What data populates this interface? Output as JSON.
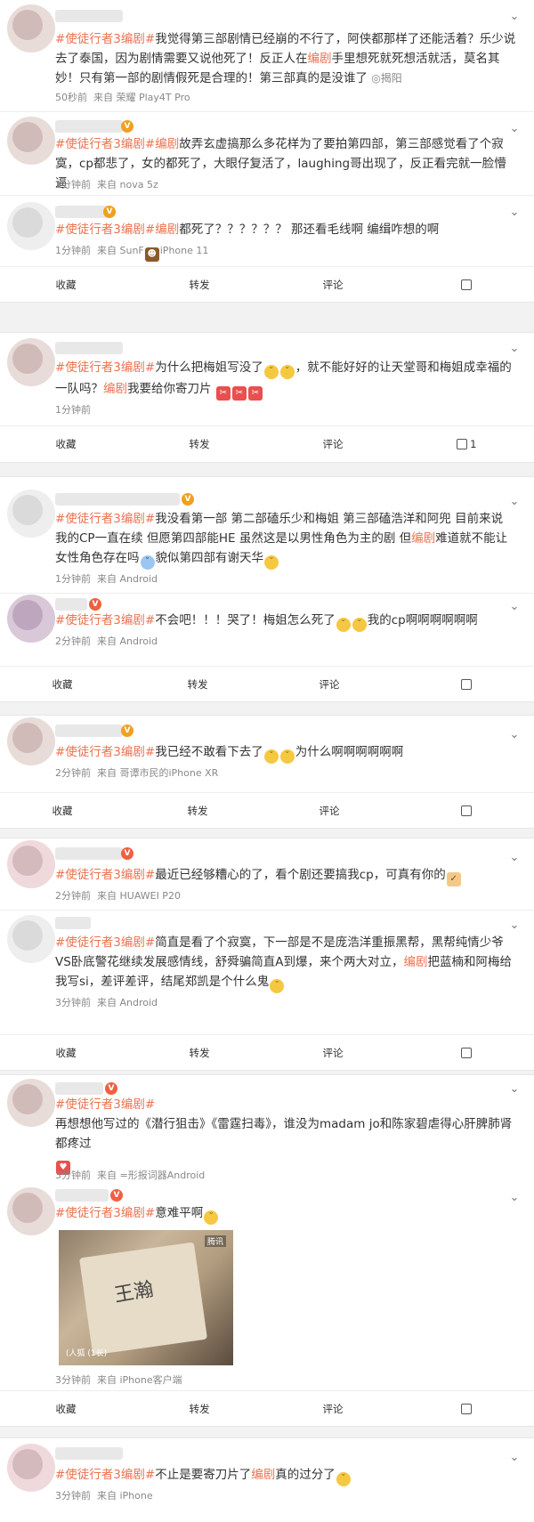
{
  "actions": {
    "collect": "收藏",
    "repost": "转发",
    "comment": "评论"
  },
  "tag": "#使徒行者3编剧#",
  "highlight": "编剧",
  "posts": [
    {
      "segments": [
        "我觉得第三部剧情已经崩的不行了，阿侠都那样了还能活着？乐少说去了泰国，因为剧情需要又说他死了！反正人在",
        "手里想死就死想活就活，莫名其妙！只有第一部的剧情假死是合理的！第三部真的是没谁了"
      ],
      "location": "揭阳",
      "time": "50秒前",
      "source": "来自 荣耀 Play4T Pro"
    },
    {
      "segments": [
        "故弄玄虚搞那么多花样为了要拍第四部，第三部感觉看了个寂寞，cp都悲了，女的都死了，大眼仔复活了，laughing哥出现了，反正看完就一脸懵逼"
      ],
      "time": "1分钟前",
      "source": "来自 nova 5z"
    },
    {
      "segments": [
        "都死了？？？？？？ 那还看毛线啊 编缉咋想的啊"
      ],
      "time": "1分钟前",
      "source_pre": "来自 SunF",
      "source_post": "iPhone 11",
      "like": ""
    },
    {
      "segments": [
        "为什么把梅姐写没了",
        "，就不能好好的让天堂哥和梅姐成幸福的一队吗？",
        "我要给你寄刀片"
      ],
      "time": "1分钟前",
      "like": "1"
    },
    {
      "segments": [
        "我没看第一部 第二部磕乐少和梅姐 第三部磕浩洋和阿兜 目前来说 我的CP一直在续 但愿第四部能HE 虽然这是以男性角色为主的剧 但",
        "难道就不能让女性角色存在吗",
        "貌似第四部有谢天华"
      ],
      "time": "1分钟前",
      "source": "来自 Android"
    },
    {
      "segments": [
        "不会吧！！！哭了！梅姐怎么死了",
        "我的cp啊啊啊啊啊啊"
      ],
      "time": "2分钟前",
      "source": "来自 Android"
    },
    {
      "segments": [
        "我已经不敢看下去了",
        "为什么啊啊啊啊啊啊"
      ],
      "time": "2分钟前",
      "source": "来自 哥谭市民的iPhone XR"
    },
    {
      "segments": [
        "最近已经够糟心的了，看个剧还要搞我cp，可真有你的"
      ],
      "time": "2分钟前",
      "source": "来自 HUAWEI P20"
    },
    {
      "segments": [
        "简直是看了个寂寞，下一部是不是庞浩洋重振黑帮，黑帮纯情少爷VS卧底警花继续发展感情线，舒舜骗简直A到爆，来个两大对立，",
        "把蓝楠和阿梅给我写si，差评差评，结尾郑凯是个什么鬼"
      ],
      "time": "3分钟前",
      "source": "来自 Android"
    },
    {
      "segments": [
        "再想想他写过的《潜行狙击》《雷霆扫毒》，谁没为madam jo和陈家碧虐得心肝脾肺肾都疼过"
      ],
      "time": "3分钟前",
      "source": "来自 =形报词器Android"
    },
    {
      "segments": [
        "意难平啊"
      ],
      "time": "3分钟前",
      "source": "来自 iPhone客户端",
      "image_caption": "(人狐 (1长)",
      "image_logo": "腾讯"
    },
    {
      "segments": [
        "不止是要寄刀片了",
        "真的过分了"
      ],
      "time": "3分钟前",
      "source": "来自 iPhone"
    }
  ]
}
